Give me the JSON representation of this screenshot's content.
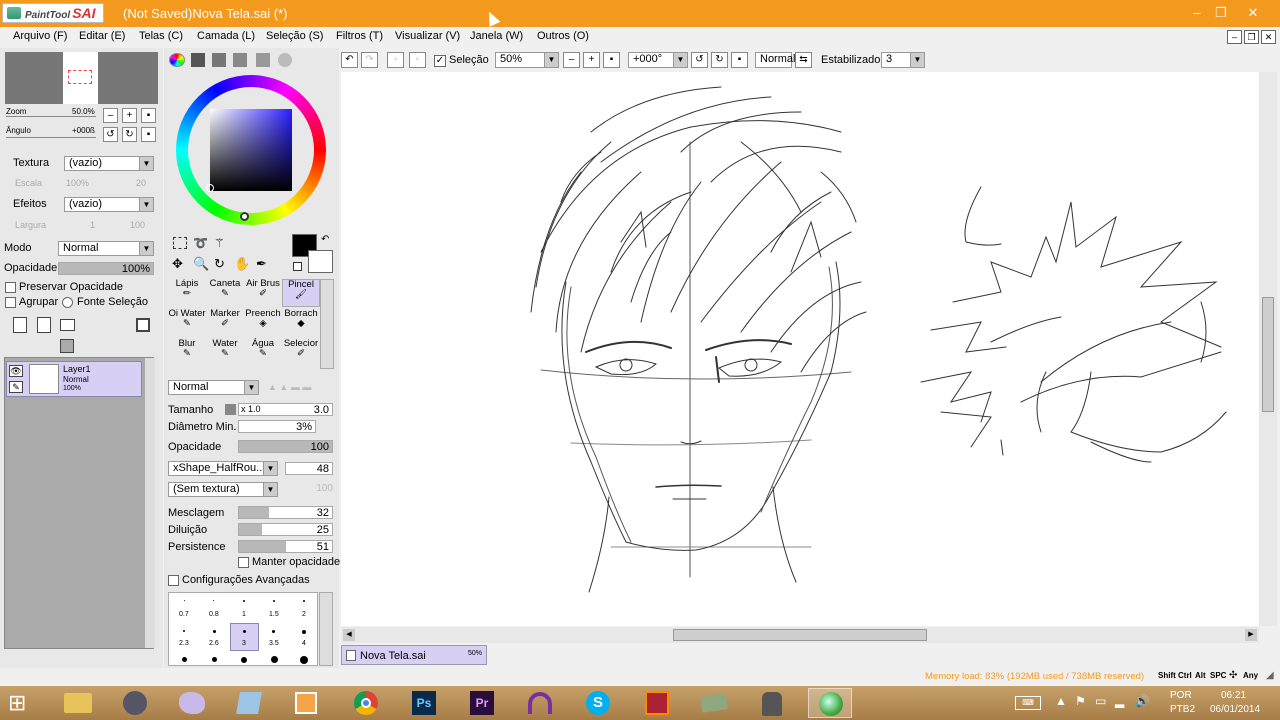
{
  "window": {
    "logo_text": "PaintTool",
    "logo_brand": "SAI",
    "title": "(Not Saved)Nova Tela.sai (*)",
    "minimize": "–",
    "maximize": "❐",
    "close": "✕"
  },
  "menu": [
    "Arquivo (F)",
    "Editar (E)",
    "Telas (C)",
    "Camada (L)",
    "Seleção (S)",
    "Filtros (T)",
    "Visualizar (V)",
    "Janela (W)",
    "Outros (O)"
  ],
  "navigator": {
    "zoom_label": "Zoom",
    "zoom_value": "50.0%",
    "angle_label": "Ângulo",
    "angle_value": "+000ß"
  },
  "texture": {
    "label": "Textura",
    "value": "(vazio)",
    "scale_label": "Escala",
    "scale_value": "100%",
    "scale_num": "20"
  },
  "effects": {
    "label": "Efeitos",
    "value": "(vazio)",
    "width_label": "Largura",
    "width_value": "1",
    "width_num": "100"
  },
  "layer_props": {
    "mode_label": "Modo",
    "mode_value": "Normal",
    "opacity_label": "Opacidade",
    "opacity_value": "100%",
    "opacity_fraction": 1.0,
    "preserve_opacity": "Preservar Opacidade",
    "group": "Agrupar",
    "selection_source": "Fonte Seleção"
  },
  "layers": [
    {
      "name": "Layer1",
      "mode": "Normal",
      "opacity": "100%"
    }
  ],
  "canvas_toolbar": {
    "selection_label": "Seleção",
    "zoom": "50%",
    "angle": "+000°",
    "blend": "Normal",
    "stabilizer_label": "Estabilizador",
    "stabilizer_value": "3"
  },
  "tools": [
    {
      "label": "Lápis",
      "selected": false
    },
    {
      "label": "Caneta",
      "selected": false
    },
    {
      "label": "Air Brus",
      "selected": false
    },
    {
      "label": "Pincel",
      "selected": true
    },
    {
      "label": "Oi Water",
      "selected": false
    },
    {
      "label": "Marker",
      "selected": false
    },
    {
      "label": "Preench",
      "selected": false
    },
    {
      "label": "Borrach",
      "selected": false
    },
    {
      "label": "Blur",
      "selected": false
    },
    {
      "label": "Water",
      "selected": false
    },
    {
      "label": "Água",
      "selected": false
    },
    {
      "label": "Selecior",
      "selected": false
    }
  ],
  "brush": {
    "blend_mode": "Normal",
    "size_label": "Tamanho",
    "size_mult": "x 1.0",
    "size_value": "3.0",
    "min_diam_label": "Diâmetro Min.",
    "min_diam_value": "3%",
    "opacity_label": "Opacidade",
    "opacity_value": "100",
    "opacity_fraction": 1.0,
    "shape": "xShape_HalfRou...",
    "shape_value": "48",
    "texture": "(Sem textura)",
    "texture_value": "100",
    "blend_label": "Mesclagem",
    "blend_value": "32",
    "blend_fraction": 0.32,
    "dilution_label": "Diluição",
    "dilution_value": "25",
    "dilution_fraction": 0.25,
    "persistence_label": "Persistence",
    "persistence_value": "51",
    "persistence_fraction": 0.51,
    "keep_opacity": "Manter opacidade",
    "advanced": "Configurações Avançadas"
  },
  "brush_sizes_row1": [
    "0.7",
    "0.8",
    "1",
    "1.5",
    "2"
  ],
  "brush_sizes_row2": [
    "2.3",
    "2.6",
    "3",
    "3.5",
    "4"
  ],
  "document_tab": {
    "name": "Nova Tela.sai",
    "zoom": "50%"
  },
  "status": {
    "memory": "Memory load: 83% (192MB used / 738MB reserved)",
    "keys": [
      "Shift",
      "Ctrl",
      "Alt",
      "SPC",
      "Any"
    ]
  },
  "taskbar": {
    "lang": "POR",
    "layout": "PTB2",
    "time": "06:21",
    "date": "06/01/2014"
  },
  "colors": {
    "titlebar": "#f39a1e",
    "selected_tool": "#d8d0f4",
    "memory_text": "#f39a1e"
  }
}
